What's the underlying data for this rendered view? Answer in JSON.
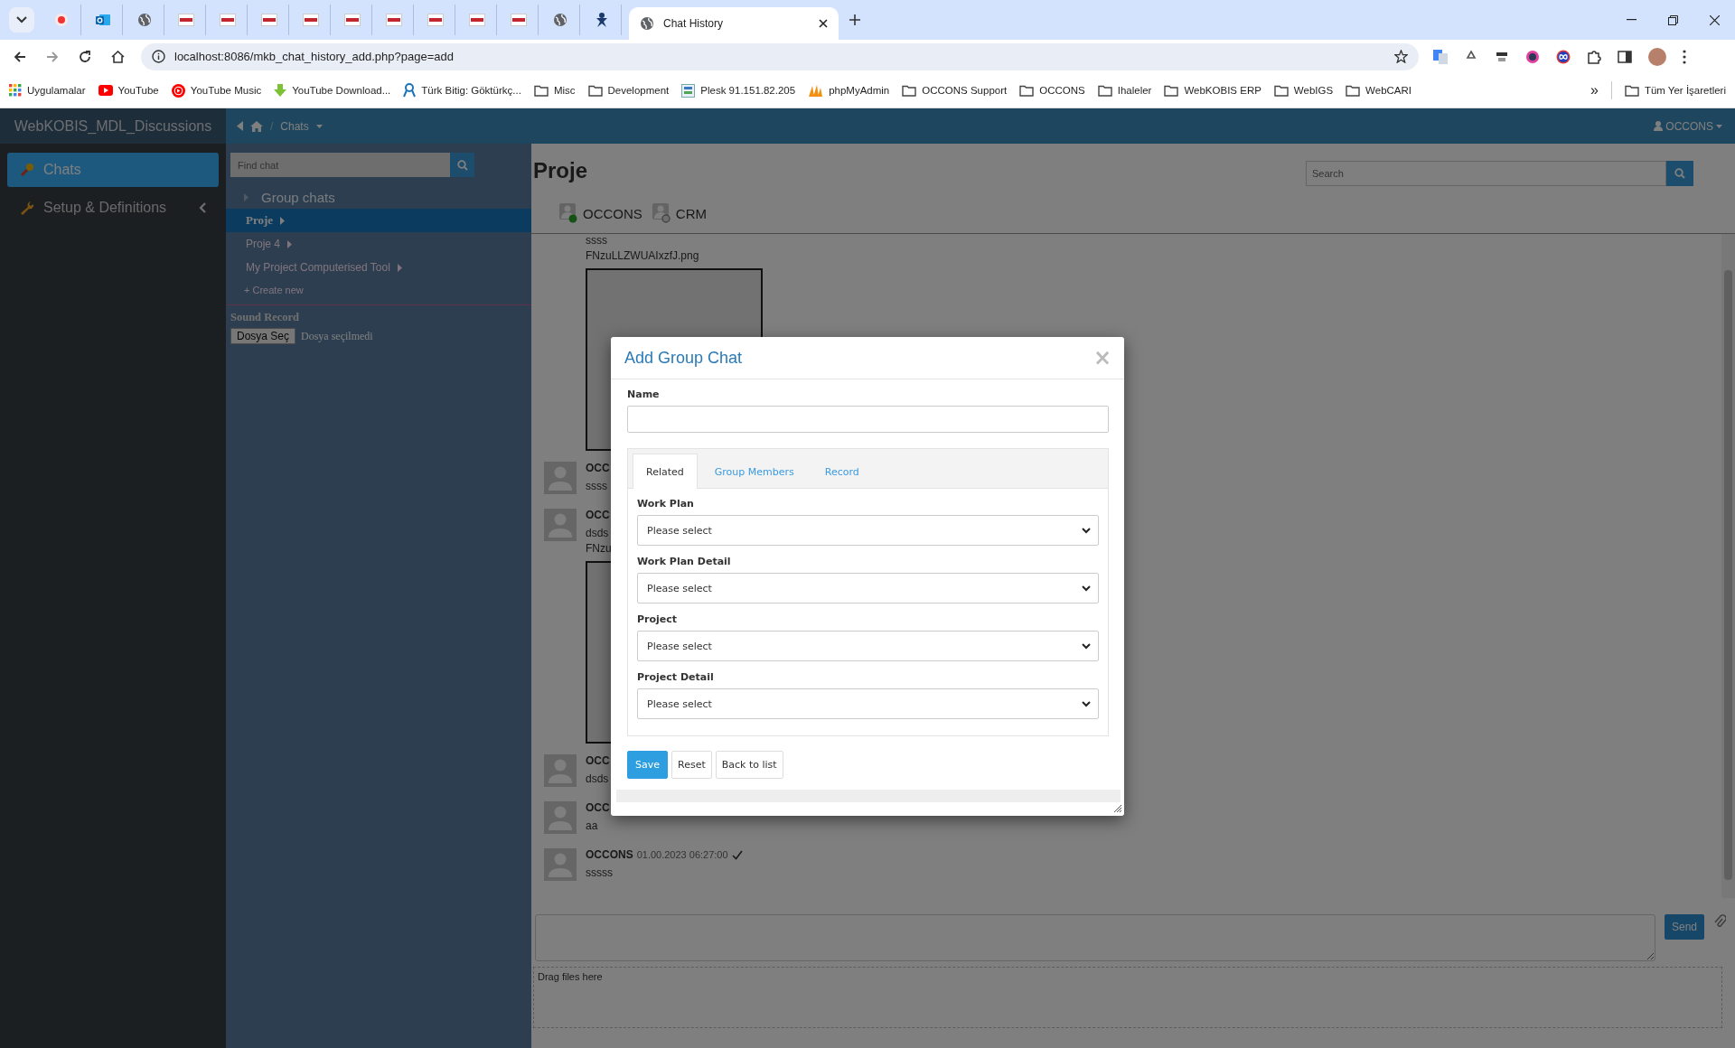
{
  "browser": {
    "tabs": [
      {
        "kind": "record",
        "selected": false
      },
      {
        "kind": "mail",
        "selected": false
      },
      {
        "kind": "globe",
        "selected": false
      },
      {
        "kind": "site",
        "selected": false
      },
      {
        "kind": "site",
        "selected": false
      },
      {
        "kind": "site",
        "selected": false
      },
      {
        "kind": "site",
        "selected": false
      },
      {
        "kind": "site",
        "selected": false
      },
      {
        "kind": "site",
        "selected": false
      },
      {
        "kind": "site",
        "selected": false
      },
      {
        "kind": "site",
        "selected": false
      },
      {
        "kind": "site",
        "selected": false
      },
      {
        "kind": "globe",
        "selected": false
      },
      {
        "kind": "figure",
        "selected": false
      },
      {
        "kind": "globe",
        "title": "Chat History",
        "selected": true
      }
    ],
    "address": "localhost:8086/mkb_chat_history_add.php?page=add",
    "bookmarks": [
      {
        "kind": "apps",
        "label": "Uygulamalar"
      },
      {
        "kind": "play",
        "label": "YouTube"
      },
      {
        "kind": "music",
        "label": "YouTube Music"
      },
      {
        "kind": "download",
        "label": "YouTube Download..."
      },
      {
        "kind": "ribbon",
        "label": "Türk Bitig: Göktürkç..."
      },
      {
        "kind": "folder",
        "label": "Misc"
      },
      {
        "kind": "folder",
        "label": "Development"
      },
      {
        "kind": "server",
        "label": "Plesk 91.151.82.205"
      },
      {
        "kind": "sail",
        "label": "phpMyAdmin"
      },
      {
        "kind": "folder",
        "label": "OCCONS Support"
      },
      {
        "kind": "folder",
        "label": "OCCONS"
      },
      {
        "kind": "folder",
        "label": "Ihaleler"
      },
      {
        "kind": "folder",
        "label": "WebKOBIS ERP"
      },
      {
        "kind": "folder",
        "label": "WebIGS"
      },
      {
        "kind": "folder",
        "label": "WebCARI"
      }
    ],
    "overflow": "»",
    "all_bookmarks": "Tüm Yer İşaretleri"
  },
  "app": {
    "brand": "WebKOBIS_MDL_Discussions",
    "separator": "/",
    "breadcrumb": "Chats",
    "user": "OCCONS"
  },
  "sidebar": {
    "items": [
      {
        "kind": "chat",
        "label": "Chats",
        "selected": true,
        "expandable": false
      },
      {
        "kind": "wrench",
        "label": "Setup & Definitions",
        "selected": false,
        "expandable": true
      }
    ]
  },
  "chat_list": {
    "search_placeholder": "Find chat",
    "group_header": "Group chats",
    "groups": [
      {
        "label": "Proje",
        "selected": true
      },
      {
        "label": "Proje 4",
        "selected": false
      },
      {
        "label": "My Project Computerised Tool",
        "selected": false
      }
    ],
    "create": "+ Create new",
    "sound_record": {
      "label": "Sound Record",
      "button": "Dosya Seç",
      "status": "Dosya seçilmedi"
    }
  },
  "chat": {
    "title": "Proje",
    "search_placeholder": "Search",
    "members": [
      {
        "name": "OCCONS",
        "online": true
      },
      {
        "name": "CRM",
        "online": false
      }
    ],
    "messages": [
      {
        "kind": "continued",
        "lines": [
          "ssss",
          "FNzuLLZWUAIxzfJ.png"
        ],
        "image": true
      },
      {
        "kind": "message",
        "author": "OCC",
        "lines": [
          "ssss"
        ],
        "image": false
      },
      {
        "kind": "message",
        "author": "OCC",
        "lines": [
          "dsds",
          "FNzu"
        ],
        "image": true
      },
      {
        "kind": "message",
        "author": "OCC",
        "lines": [
          "dsds"
        ],
        "image": false
      },
      {
        "kind": "message",
        "author": "OCC",
        "lines": [
          "aa"
        ],
        "image": false
      },
      {
        "kind": "message",
        "author": "OCCONS",
        "time": "01.00.2023 06:27:00",
        "read": true,
        "lines": [
          "sssss"
        ],
        "image": false
      }
    ],
    "send": "Send",
    "dropzone": "Drag files here"
  },
  "modal": {
    "title": "Add Group Chat",
    "close": "×",
    "name_label": "Name",
    "tabs": [
      {
        "label": "Related",
        "selected": true
      },
      {
        "label": "Group Members",
        "selected": false
      },
      {
        "label": "Record",
        "selected": false
      }
    ],
    "selects": [
      {
        "label": "Work Plan",
        "value": "Please select"
      },
      {
        "label": "Work Plan Detail",
        "value": "Please select"
      },
      {
        "label": "Project",
        "value": "Please select"
      },
      {
        "label": "Project Detail",
        "value": "Please select"
      }
    ],
    "buttons": [
      {
        "label": "Save",
        "kind": "primary"
      },
      {
        "label": "Reset",
        "kind": "default"
      },
      {
        "label": "Back to list",
        "kind": "default"
      }
    ]
  }
}
